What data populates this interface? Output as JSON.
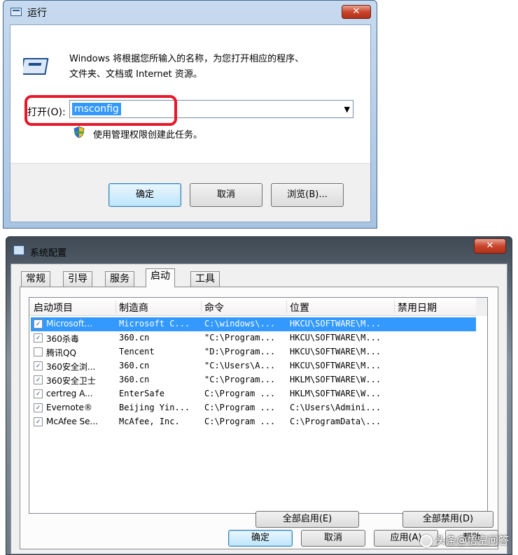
{
  "run_dialog": {
    "title": "运行",
    "close": "✕",
    "description_line1": "Windows 将根据您所输入的名称，为您打开相应的程序、",
    "description_line2": "文件夹、文档或 Internet 资源。",
    "open_label": "打开(O):",
    "open_value": "msconfig",
    "admin_note": "使用管理权限创建此任务。",
    "buttons": {
      "ok": "确定",
      "cancel": "取消",
      "browse": "浏览(B)..."
    },
    "highlight_color": "#e6192b"
  },
  "config_dialog": {
    "title": "系统配置",
    "close": "✕",
    "tabs": [
      "常规",
      "引导",
      "服务",
      "启动",
      "工具"
    ],
    "active_tab": "启动",
    "columns": [
      "启动项目",
      "制造商",
      "命令",
      "位置",
      "禁用日期"
    ],
    "rows": [
      {
        "checked": true,
        "selected": true,
        "name": "Microsoft...",
        "maker": "Microsoft C...",
        "command": "C:\\windows\\...",
        "location": "HKCU\\SOFTWARE\\M...",
        "date": ""
      },
      {
        "checked": true,
        "selected": false,
        "name": "360杀毒",
        "maker": "360.cn",
        "command": "\"C:\\Program...",
        "location": "HKCU\\SOFTWARE\\M...",
        "date": ""
      },
      {
        "checked": false,
        "selected": false,
        "name": "腾讯QQ",
        "maker": "Tencent",
        "command": "\"D:\\Program...",
        "location": "HKCU\\SOFTWARE\\M...",
        "date": ""
      },
      {
        "checked": true,
        "selected": false,
        "name": "360安全浏...",
        "maker": "360.cn",
        "command": "\"C:\\Users\\A...",
        "location": "HKCU\\SOFTWARE\\M...",
        "date": ""
      },
      {
        "checked": true,
        "selected": false,
        "name": "360安全卫士",
        "maker": "360.cn",
        "command": "\"C:\\Program...",
        "location": "HKLM\\SOFTWARE\\W...",
        "date": ""
      },
      {
        "checked": true,
        "selected": false,
        "name": "certreg A...",
        "maker": "EnterSafe",
        "command": "C:\\Program ...",
        "location": "HKLM\\SOFTWARE\\W...",
        "date": ""
      },
      {
        "checked": true,
        "selected": false,
        "name": "Evernote®",
        "maker": "Beijing Yin...",
        "command": "C:\\Program ...",
        "location": "C:\\Users\\Admini...",
        "date": ""
      },
      {
        "checked": true,
        "selected": false,
        "name": "McAfee Se...",
        "maker": "McAfee, Inc.",
        "command": "C:\\Program ...",
        "location": "C:\\ProgramData\\...",
        "date": ""
      }
    ],
    "buttons": {
      "enable_all": "全部启用(E)",
      "disable_all": "全部禁用(D)",
      "ok": "确定",
      "cancel": "取消",
      "apply": "应用(A)",
      "help": "帮助"
    },
    "selection_color": "#3399ff"
  },
  "watermark": "头条@悟空问答"
}
